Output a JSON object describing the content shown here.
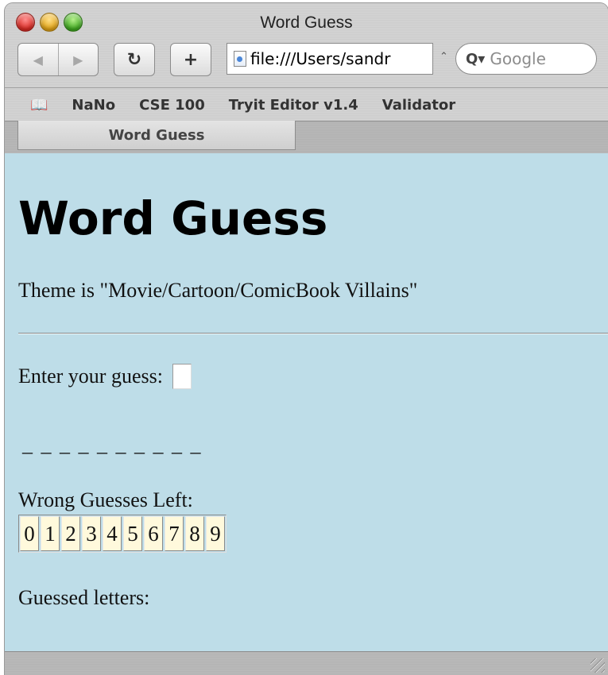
{
  "window": {
    "title": "Word Guess"
  },
  "toolbar": {
    "reload_glyph": "↻",
    "add_glyph": "+",
    "back_glyph": "◀",
    "forward_glyph": "▶",
    "url": "file:///Users/sandr",
    "snapback_glyph": "⌃",
    "search_icon_glyph": "Q▾",
    "search_placeholder": "Google"
  },
  "bookmarks": {
    "book_glyph": "📖",
    "items": [
      {
        "label": "NaNo"
      },
      {
        "label": "CSE 100"
      },
      {
        "label": "Tryit Editor v1.4"
      },
      {
        "label": "Validator"
      }
    ]
  },
  "tabs": [
    {
      "label": "Word Guess",
      "active": true
    }
  ],
  "page": {
    "heading": "Word Guess",
    "theme_text": "Theme is \"Movie/Cartoon/ComicBook Villains\"",
    "guess_label": "Enter your guess:",
    "guess_value": "",
    "blanks": "_ _ _ _ _ _ _ _ _ _",
    "wrong_label": "Wrong Guesses Left:",
    "counter": [
      "0",
      "1",
      "2",
      "3",
      "4",
      "5",
      "6",
      "7",
      "8",
      "9"
    ],
    "guessed_label": "Guessed letters:"
  },
  "colors": {
    "page_background": "#bedde8",
    "counter_cell": "#fff9dc"
  }
}
